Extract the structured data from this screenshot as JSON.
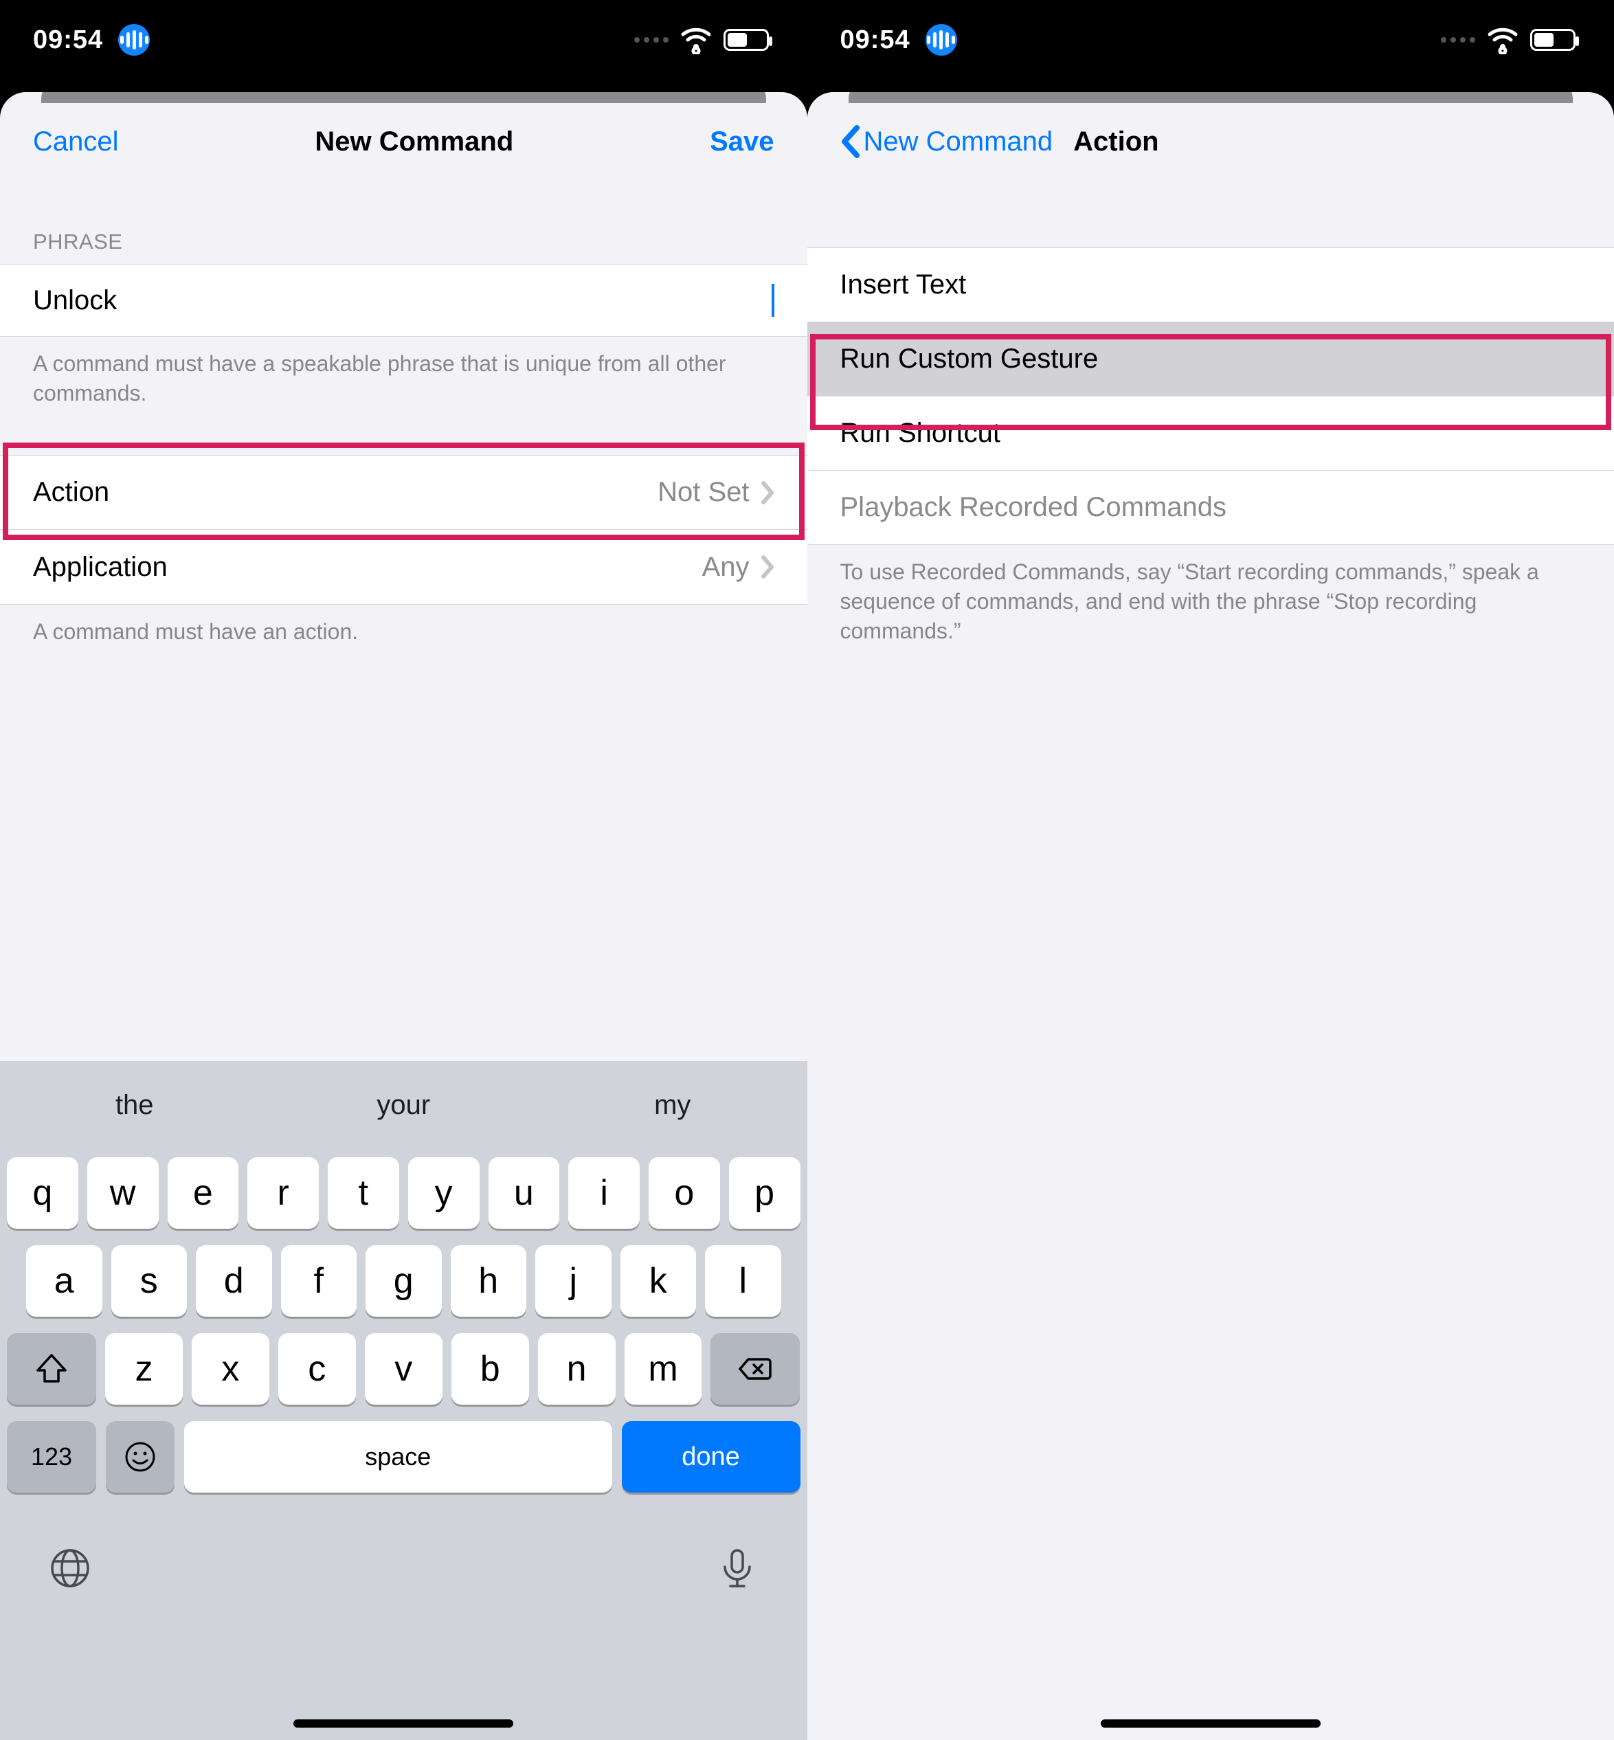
{
  "status": {
    "time": "09:54",
    "battery_pct": 48
  },
  "left_screen": {
    "nav": {
      "cancel": "Cancel",
      "title": "New Command",
      "save": "Save"
    },
    "phrase_header": "PHRASE",
    "phrase_value": "Unlock",
    "phrase_footer": "A command must have a speakable phrase that is unique from all other commands.",
    "rows": {
      "action_label": "Action",
      "action_value": "Not Set",
      "application_label": "Application",
      "application_value": "Any"
    },
    "rows_footer": "A command must have an action.",
    "keyboard": {
      "suggestions": [
        "the",
        "your",
        "my"
      ],
      "row1": [
        "q",
        "w",
        "e",
        "r",
        "t",
        "y",
        "u",
        "i",
        "o",
        "p"
      ],
      "row2": [
        "a",
        "s",
        "d",
        "f",
        "g",
        "h",
        "j",
        "k",
        "l"
      ],
      "row3": [
        "z",
        "x",
        "c",
        "v",
        "b",
        "n",
        "m"
      ],
      "num": "123",
      "space": "space",
      "done": "done"
    }
  },
  "right_screen": {
    "nav": {
      "back": "New Command",
      "title": "Action"
    },
    "actions": {
      "insert_text": "Insert Text",
      "run_gesture": "Run Custom Gesture",
      "run_shortcut": "Run Shortcut",
      "playback": "Playback Recorded Commands"
    },
    "footer": "To use Recorded Commands, say “Start recording commands,” speak a sequence of commands, and end with the phrase “Stop recording commands.”"
  },
  "colors": {
    "accent": "#0079ff",
    "highlight": "#d31f5a"
  }
}
